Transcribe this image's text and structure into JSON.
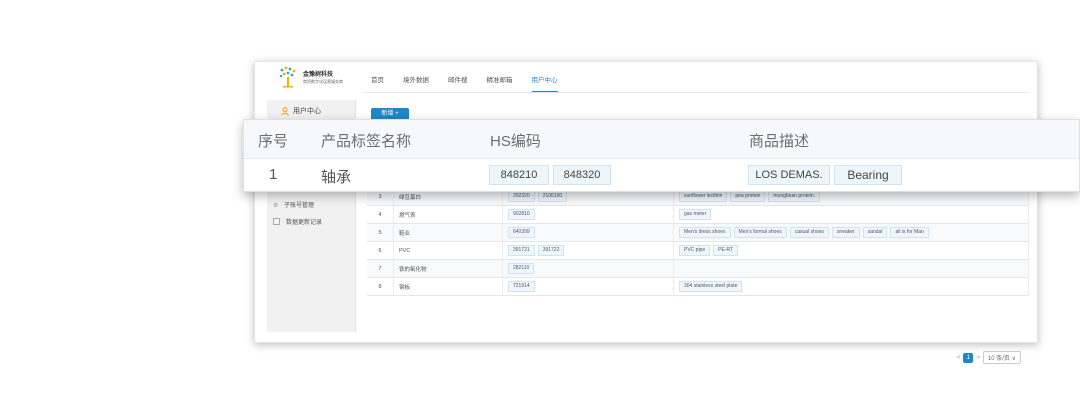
{
  "logo": {
    "title": "金豫树科技",
    "subtitle": "商贸数字化运营服务商"
  },
  "nav": [
    "首页",
    "境外数据",
    "邮件搜",
    "精准邮箱",
    "用户中心"
  ],
  "sidebar": {
    "user_label": "用户中心",
    "items": [
      "子账号管理",
      "数据更新记录"
    ]
  },
  "new_button": "新增 +",
  "zoom_table": {
    "headers": {
      "no": "序号",
      "name": "产品标签名称",
      "hs": "HS编码",
      "desc": "商品描述"
    },
    "row": {
      "no": "1",
      "name": "轴承",
      "hs": [
        "848210",
        "848320"
      ],
      "desc": [
        "LOS DEMAS.",
        "Bearing"
      ]
    }
  },
  "rows": [
    {
      "no": "3",
      "name": "绿豆蛋白",
      "hs": [
        "292320",
        "2106100"
      ],
      "desc": [
        "sunflower lecithin",
        "pea protein",
        "mungbean protein."
      ]
    },
    {
      "no": "4",
      "name": "燃气表",
      "hs": [
        "902810"
      ],
      "desc": [
        "gas meter"
      ]
    },
    {
      "no": "5",
      "name": "鞋业",
      "hs": [
        "640399"
      ],
      "desc": [
        "Men's dress shoes",
        "Men's formal shoes",
        "casual shoes",
        "sneaker",
        "sandal",
        "all is for Man"
      ]
    },
    {
      "no": "6",
      "name": "PVC",
      "hs": [
        "391721",
        "391722"
      ],
      "desc": [
        "PVC pipe",
        "PE-RT"
      ]
    },
    {
      "no": "7",
      "name": "铁的氧化物",
      "hs": [
        "282110"
      ],
      "desc": []
    },
    {
      "no": "8",
      "name": "钢板",
      "hs": [
        "721914"
      ],
      "desc": [
        "304 stainless steel plate"
      ]
    }
  ],
  "pager": {
    "prev": "<",
    "current": "1",
    "next": ">",
    "page_size": "10 条/页 ∨"
  },
  "colors": {
    "accent": "#1e88c9"
  }
}
